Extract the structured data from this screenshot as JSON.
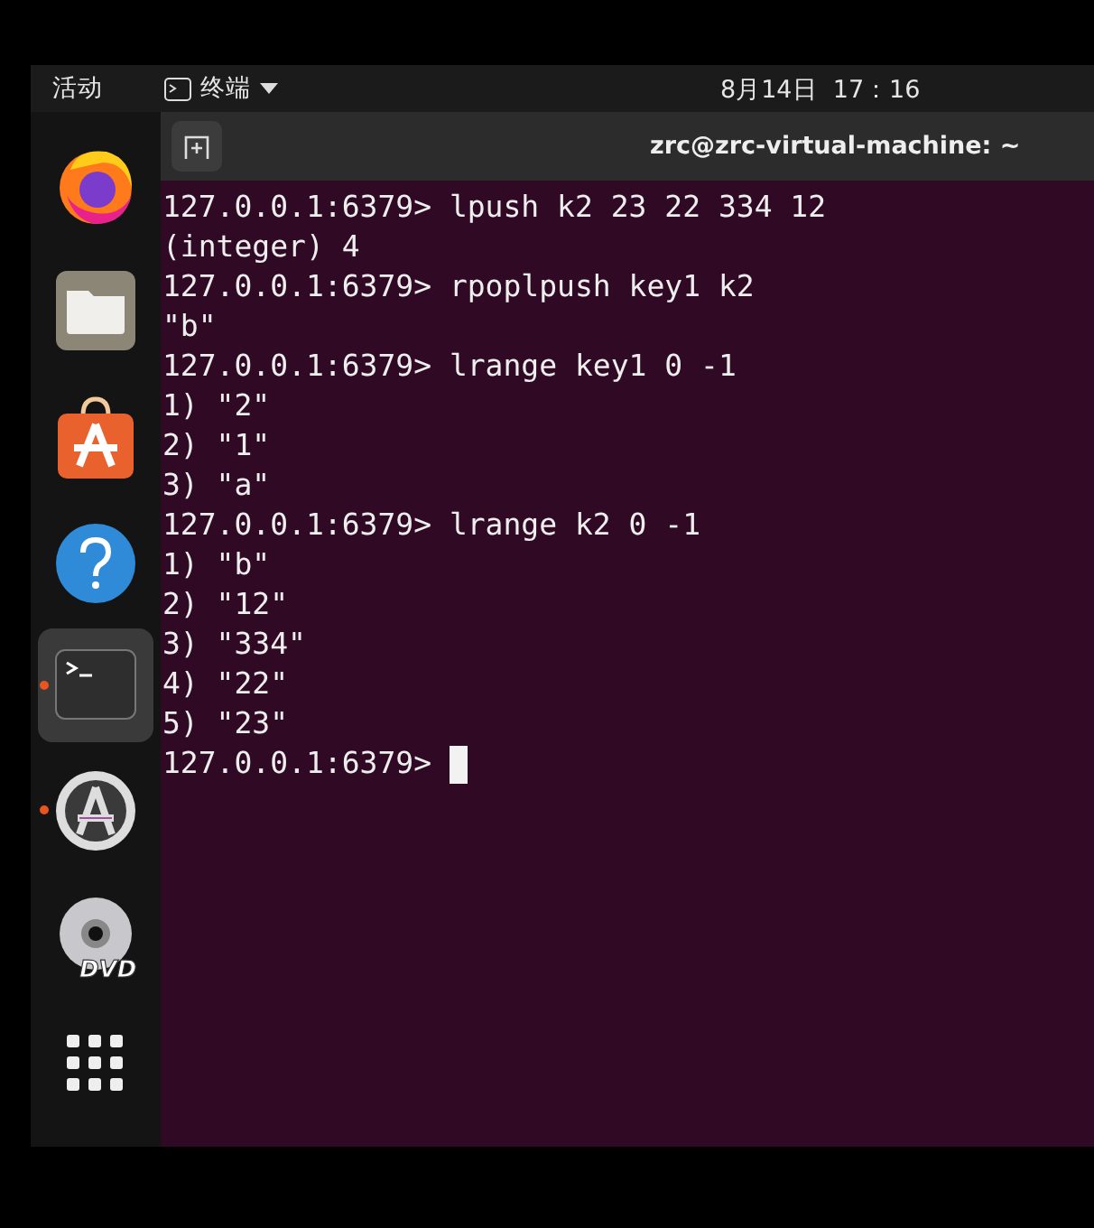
{
  "top_bar": {
    "activities": "活动",
    "app_menu": "终端",
    "clock": "8月14日  17：16"
  },
  "dock": {
    "items": [
      {
        "kind": "firefox",
        "running": false,
        "selected": false
      },
      {
        "kind": "files",
        "running": false,
        "selected": false
      },
      {
        "kind": "software",
        "running": false,
        "selected": false
      },
      {
        "kind": "help",
        "running": false,
        "selected": false
      },
      {
        "kind": "terminal",
        "running": true,
        "selected": true
      },
      {
        "kind": "updater",
        "running": true,
        "selected": false
      },
      {
        "kind": "dvd",
        "running": false,
        "selected": false,
        "label": "DVD"
      },
      {
        "kind": "apps",
        "running": false,
        "selected": false
      }
    ]
  },
  "window": {
    "title": "zrc@zrc-virtual-machine: ~"
  },
  "terminal": {
    "lines": [
      "127.0.0.1:6379> lpush k2 23 22 334 12",
      "(integer) 4",
      "127.0.0.1:6379> rpoplpush key1 k2",
      "\"b\"",
      "127.0.0.1:6379> lrange key1 0 -1",
      "1) \"2\"",
      "2) \"1\"",
      "3) \"a\"",
      "127.0.0.1:6379> lrange k2 0 -1",
      "1) \"b\"",
      "2) \"12\"",
      "3) \"334\"",
      "4) \"22\"",
      "5) \"23\"",
      "127.0.0.1:6379>"
    ],
    "cursor": true
  }
}
